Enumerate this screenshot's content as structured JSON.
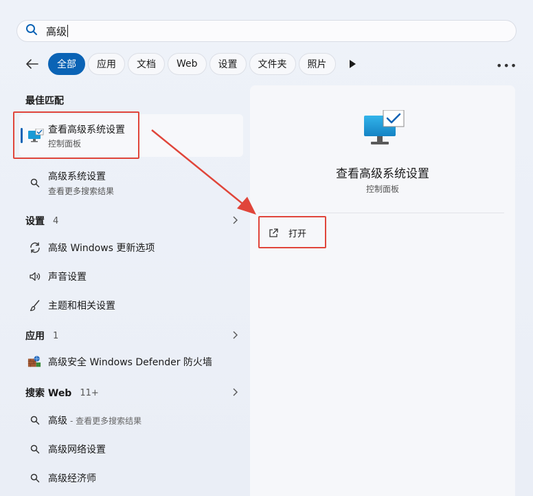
{
  "search": {
    "query": "高级"
  },
  "filters": {
    "chips": [
      "全部",
      "应用",
      "文档",
      "Web",
      "设置",
      "文件夹",
      "照片"
    ],
    "active_index": 0
  },
  "best_match": {
    "heading": "最佳匹配",
    "title": "查看高级系统设置",
    "subtitle": "控制面板"
  },
  "search_suggestion": {
    "title": "高级系统设置",
    "subtitle": "查看更多搜索结果"
  },
  "settings": {
    "heading": "设置",
    "count": "4",
    "items": [
      "高级 Windows 更新选项",
      "声音设置",
      "主题和相关设置"
    ]
  },
  "apps": {
    "heading": "应用",
    "count": "1",
    "items": [
      "高级安全 Windows Defender 防火墙"
    ]
  },
  "web": {
    "heading": "搜索 Web",
    "count": "11+",
    "items": [
      {
        "title": "高级",
        "suffix": "- 查看更多搜索结果"
      },
      {
        "title": "高级网络设置",
        "suffix": ""
      },
      {
        "title": "高级经济师",
        "suffix": ""
      }
    ]
  },
  "detail": {
    "title": "查看高级系统设置",
    "subtitle": "控制面板",
    "open_label": "打开"
  },
  "colors": {
    "accent": "#0a63b5",
    "annotation": "#e0453a"
  }
}
